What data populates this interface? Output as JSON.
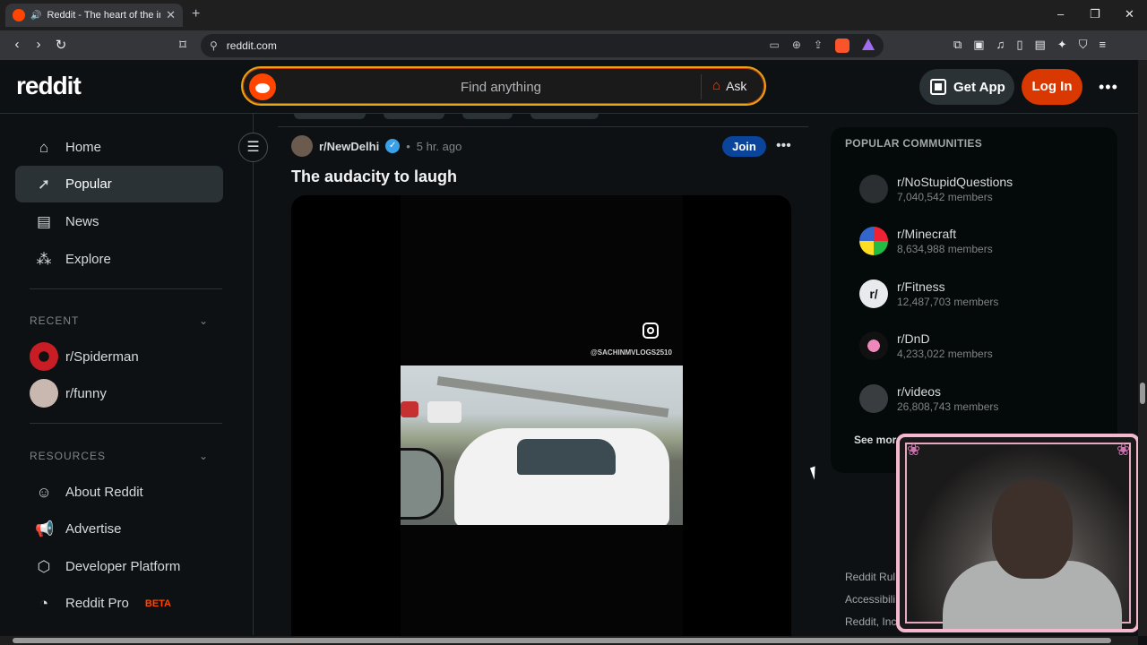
{
  "browser": {
    "tab_title": "Reddit - The heart of the inte",
    "new_tab_icon": "+",
    "url": "reddit.com",
    "window": {
      "minimize": "–",
      "restore": "❐",
      "close": "✕"
    }
  },
  "header": {
    "logo": "reddit",
    "search_placeholder": "Find anything",
    "ask_label": "Ask",
    "get_app_label": "Get App",
    "login_label": "Log In",
    "more_icon": "•••"
  },
  "sidebar": {
    "nav": [
      {
        "label": "Home",
        "icon": "home-icon"
      },
      {
        "label": "Popular",
        "icon": "popular-icon"
      },
      {
        "label": "News",
        "icon": "news-icon"
      },
      {
        "label": "Explore",
        "icon": "explore-icon"
      }
    ],
    "recent_heading": "RECENT",
    "recent": [
      {
        "label": "r/Spiderman"
      },
      {
        "label": "r/funny"
      }
    ],
    "resources_heading": "RESOURCES",
    "resources": [
      {
        "label": "About Reddit"
      },
      {
        "label": "Advertise"
      },
      {
        "label": "Developer Platform"
      },
      {
        "label": "Reddit Pro",
        "badge": "BETA"
      }
    ]
  },
  "post": {
    "subreddit": "r/NewDelhi",
    "time": "5 hr. ago",
    "separator": "•",
    "join_label": "Join",
    "title": "The audacity to laugh",
    "watermark": "@SACHINMVLOGS2510"
  },
  "right_sidebar": {
    "title": "POPULAR COMMUNITIES",
    "communities": [
      {
        "name": "r/NoStupidQuestions",
        "members": "7,040,542 members"
      },
      {
        "name": "r/Minecraft",
        "members": "8,634,988 members"
      },
      {
        "name": "r/Fitness",
        "members": "12,487,703 members"
      },
      {
        "name": "r/DnD",
        "members": "4,233,022 members"
      },
      {
        "name": "r/videos",
        "members": "26,808,743 members"
      }
    ],
    "see_more": "See more",
    "footer_links": [
      "Reddit Rul",
      "Accessibili",
      "Reddit, Inc"
    ]
  },
  "colors": {
    "accent": "#ff4500",
    "login_bg": "#d93900",
    "join_bg": "#0a449b"
  }
}
